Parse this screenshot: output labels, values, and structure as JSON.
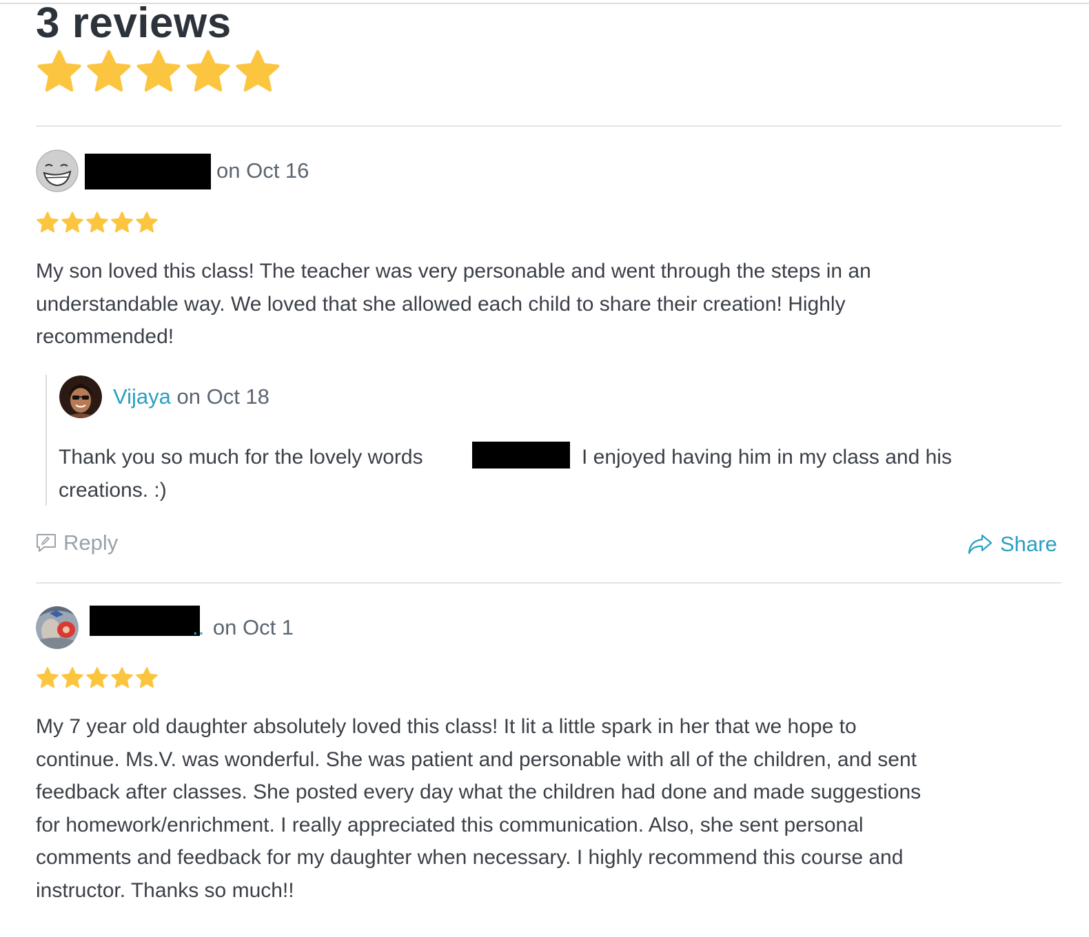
{
  "summary": {
    "title": "3 reviews",
    "rating": 5,
    "max_rating": 5
  },
  "reviews": [
    {
      "date_text": "on Oct 16",
      "rating": 5,
      "text_lines": [
        "My son loved this class! The teacher was very personable and went through the steps in an",
        "understandable way. We loved that she allowed each child to share their creation! Highly",
        "recommended!"
      ],
      "response": {
        "author": "Vijaya",
        "date_text": "on Oct 18",
        "text_part1": "Thank you so much for the lovely words",
        "text_part2": "I enjoyed having him in my class and his",
        "text_line2": "creations. :)"
      },
      "actions": {
        "reply_label": "Reply",
        "share_label": "Share"
      }
    },
    {
      "name_fragment": "..",
      "date_text": "on Oct 1",
      "rating": 5,
      "text_lines": [
        "My 7 year old daughter absolutely loved this class!  It lit a little spark in her that we hope to",
        "continue.  Ms.V. was wonderful.  She was patient and personable with all of the children, and sent",
        "feedback after classes.  She posted every day what the children had done and made suggestions",
        "for homework/enrichment.  I really appreciated this communication.  Also, she sent personal",
        "comments and feedback for my daughter when necessary.  I highly recommend this course and",
        "instructor.  Thanks so much!!"
      ]
    }
  ],
  "colors": {
    "star": "#fcc540",
    "link": "#2a9fc2",
    "muted": "#9aa1a9",
    "text": "#3a3f47",
    "divider": "#e3e3e3"
  },
  "icons": {
    "star": "star-icon",
    "reply": "comment-icon",
    "share": "share-arrow-icon"
  }
}
